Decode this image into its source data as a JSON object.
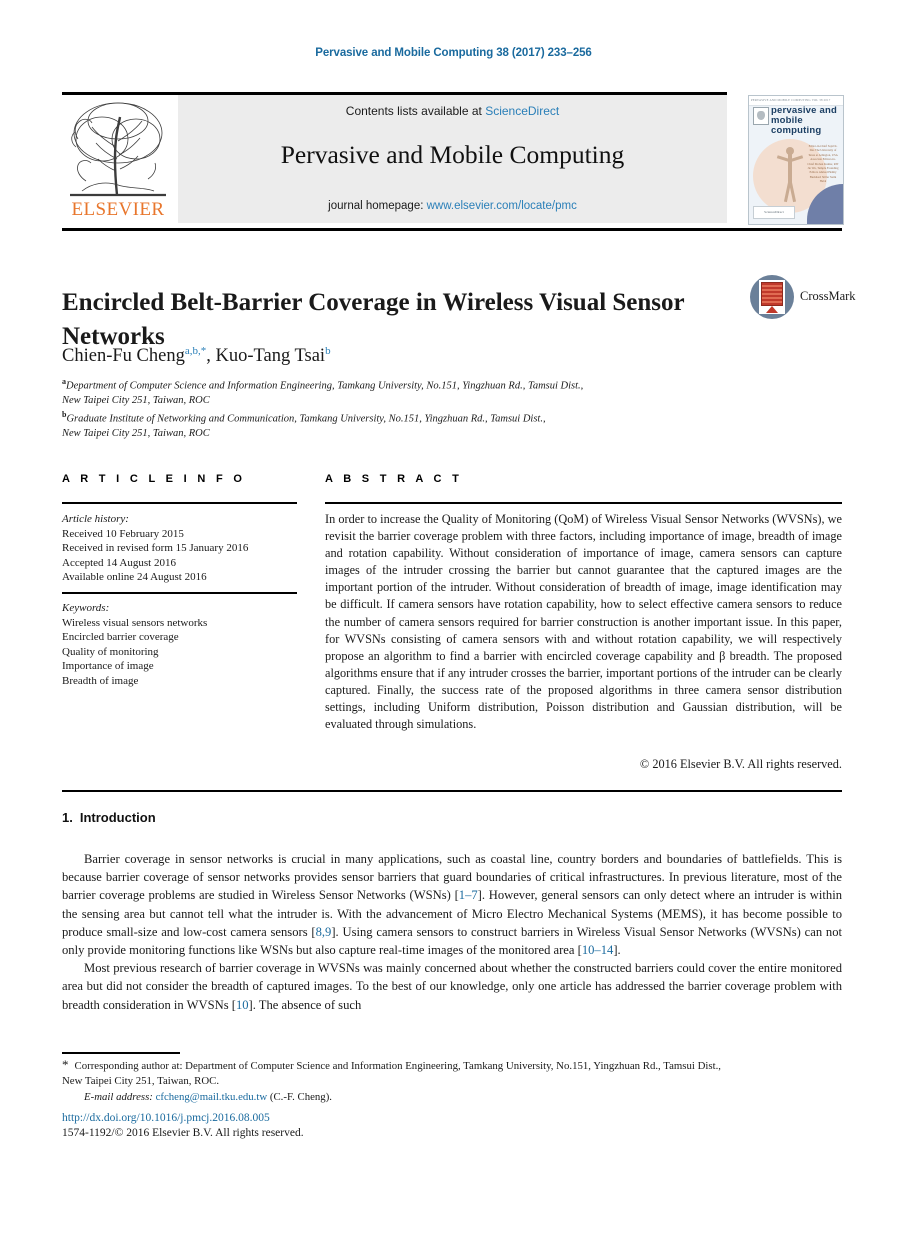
{
  "running_head": "Pervasive and Mobile Computing 38 (2017) 233–256",
  "masthead": {
    "publisher_wordmark": "ELSEVIER",
    "contents_prefix": "Contents lists available at ",
    "contents_link": "ScienceDirect",
    "journal_title": "Pervasive and Mobile Computing",
    "homepage_prefix": "journal homepage: ",
    "homepage_link": "www.elsevier.com/locate/pmc"
  },
  "cover_thumbnail": {
    "top_bar": "PERVASIVE AND MOBILE COMPUTING            VOL 38  2017",
    "title": "pervasive and mobile computing",
    "side_text": "Editor-in-Chief Sajal K. Das The University of Texas at Arlington, USA    Associate Editors-in-Chief Mohan Kumar, RIT  Jie Wu, Temple    Founding Editors Ahmed Helmy Burkhard Stiller Sumi Helal",
    "footer_badge": "ScienceDirect"
  },
  "crossmark": {
    "label": "CrossMark"
  },
  "title": "Encircled Belt-Barrier Coverage in Wireless Visual Sensor Networks",
  "authors": [
    {
      "name": "Chien-Fu Cheng",
      "sup": "a,b,*"
    },
    {
      "name": "Kuo-Tang Tsai",
      "sup": "b"
    }
  ],
  "affiliations": [
    {
      "marker": "a",
      "line1": "Department of Computer Science and Information Engineering, Tamkang University, No.151, Yingzhuan Rd., Tamsui Dist.,",
      "line2": "New Taipei City 251, Taiwan, ROC"
    },
    {
      "marker": "b",
      "line1": "Graduate Institute of Networking and Communication, Tamkang University, No.151, Yingzhuan Rd., Tamsui Dist.,",
      "line2": "New Taipei City 251, Taiwan, ROC"
    }
  ],
  "section_headers": {
    "article_info": "A R T I C L E  I N F O",
    "abstract": "A B S T R A C T"
  },
  "article_history": {
    "heading": "Article history:",
    "items": [
      "Received 10 February 2015",
      "Received in revised form 15 January 2016",
      "Accepted 14 August 2016",
      "Available online 24 August 2016"
    ]
  },
  "keywords": {
    "heading": "Keywords:",
    "items": [
      "Wireless visual sensors networks",
      "Encircled barrier coverage",
      "Quality of monitoring",
      "Importance of image",
      "Breadth of image"
    ]
  },
  "abstract": "In order to increase the Quality of Monitoring (QoM) of Wireless Visual Sensor Networks (WVSNs), we revisit the barrier coverage problem with three factors, including importance of image, breadth of image and rotation capability. Without consideration of importance of image, camera sensors can capture images of the intruder crossing the barrier but cannot guarantee that the captured images are the important portion of the intruder. Without consideration of breadth of image, image identification may be difficult. If camera sensors have rotation capability, how to select effective camera sensors to reduce the number of camera sensors required for barrier construction is another important issue. In this paper, for WVSNs consisting of camera sensors with and without rotation capability, we will respectively propose an algorithm to find a barrier with encircled coverage capability and β breadth. The proposed algorithms ensure that if any intruder crosses the barrier, important portions of the intruder can be clearly captured. Finally, the success rate of the proposed algorithms in three camera sensor distribution settings, including Uniform distribution, Poisson distribution and Gaussian distribution, will be evaluated through simulations.",
  "copyright": "© 2016 Elsevier B.V. All rights reserved.",
  "introduction": {
    "number": "1.",
    "heading": "Introduction",
    "paragraph1_a": "Barrier coverage in sensor networks is crucial in many applications, such as coastal line, country borders and boundaries of battlefields. This is because barrier coverage of sensor networks provides sensor barriers that guard boundaries of critical infrastructures. In previous literature, most of the barrier coverage problems are studied in Wireless Sensor Networks (WSNs) [",
    "ref1": "1–7",
    "paragraph1_b": "]. However, general sensors can only detect where an intruder is within the sensing area but cannot tell what the intruder is. With the advancement of Micro Electro Mechanical Systems (MEMS), it has become possible to produce small-size and low-cost camera sensors [",
    "ref2": "8,9",
    "paragraph1_c": "]. Using camera sensors to construct barriers in Wireless Visual Sensor Networks (WVSNs) can not only provide monitoring functions like WSNs but also capture real-time images of the monitored area [",
    "ref3": "10–14",
    "paragraph1_d": "].",
    "paragraph2_a": "Most previous research of barrier coverage in WVSNs was mainly concerned about whether the constructed barriers could cover the entire monitored area but did not consider the breadth of captured images. To the best of our knowledge, only one article has addressed the barrier coverage problem with breadth consideration in WVSNs [",
    "ref4": "10",
    "paragraph2_b": "]. The absence of such"
  },
  "footnote": {
    "star": "*",
    "corresponding_a": "Corresponding author at: Department of Computer Science and Information Engineering, Tamkang University, No.151, Yingzhuan Rd., Tamsui Dist.,",
    "corresponding_b": "New Taipei City 251, Taiwan, ROC.",
    "email_label": "E-mail address:",
    "email": "cfcheng@mail.tku.edu.tw",
    "email_suffix": "(C.-F. Cheng)."
  },
  "doi": "http://dx.doi.org/10.1016/j.pmcj.2016.08.005",
  "issn": "1574-1192/© 2016 Elsevier B.V. All rights reserved.",
  "colors": {
    "link_blue": "#2a7fb8",
    "ref_blue": "#1a6a9e",
    "elsevier_orange": "#e8762c",
    "band_grey": "#ececec",
    "crossmark_blue": "#6b8099",
    "crossmark_red": "#c0392b"
  }
}
